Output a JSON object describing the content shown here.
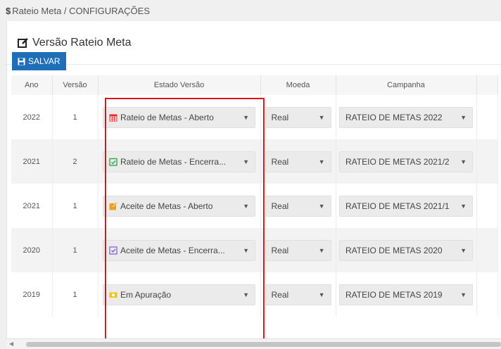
{
  "breadcrumb": {
    "symbol": "$",
    "text": "Rateio Meta / CONFIGURAÇÕES"
  },
  "page": {
    "title": "Versão Rateio Meta"
  },
  "toolbar": {
    "save_label": "SALVAR"
  },
  "table": {
    "headers": [
      "Ano",
      "Versão",
      "Estado Versão",
      "Moeda",
      "Campanha"
    ],
    "rows": [
      {
        "ano": "2022",
        "versao": "1",
        "estado": "Rateio de Metas - Aberto",
        "estado_icon": "calendar-red-icon",
        "moeda": "Real",
        "campanha": "RATEIO DE METAS 2022"
      },
      {
        "ano": "2021",
        "versao": "2",
        "estado": "Rateio de Metas - Encerra...",
        "estado_icon": "calendar-check-green-icon",
        "moeda": "Real",
        "campanha": "RATEIO DE METAS 2021/2"
      },
      {
        "ano": "2021",
        "versao": "1",
        "estado": "Aceite de Metas - Aberto",
        "estado_icon": "edit-orange-icon",
        "moeda": "Real",
        "campanha": "RATEIO DE METAS 2021/1"
      },
      {
        "ano": "2020",
        "versao": "1",
        "estado": "Aceite de Metas - Encerra...",
        "estado_icon": "checkbox-purple-icon",
        "moeda": "Real",
        "campanha": "RATEIO DE METAS 2020"
      },
      {
        "ano": "2019",
        "versao": "1",
        "estado": "Em Apuração",
        "estado_icon": "money-yellow-icon",
        "moeda": "Real",
        "campanha": "RATEIO DE METAS 2019"
      }
    ]
  },
  "colors": {
    "accent": "#1f6fb8",
    "highlight_box": "#e01010"
  }
}
